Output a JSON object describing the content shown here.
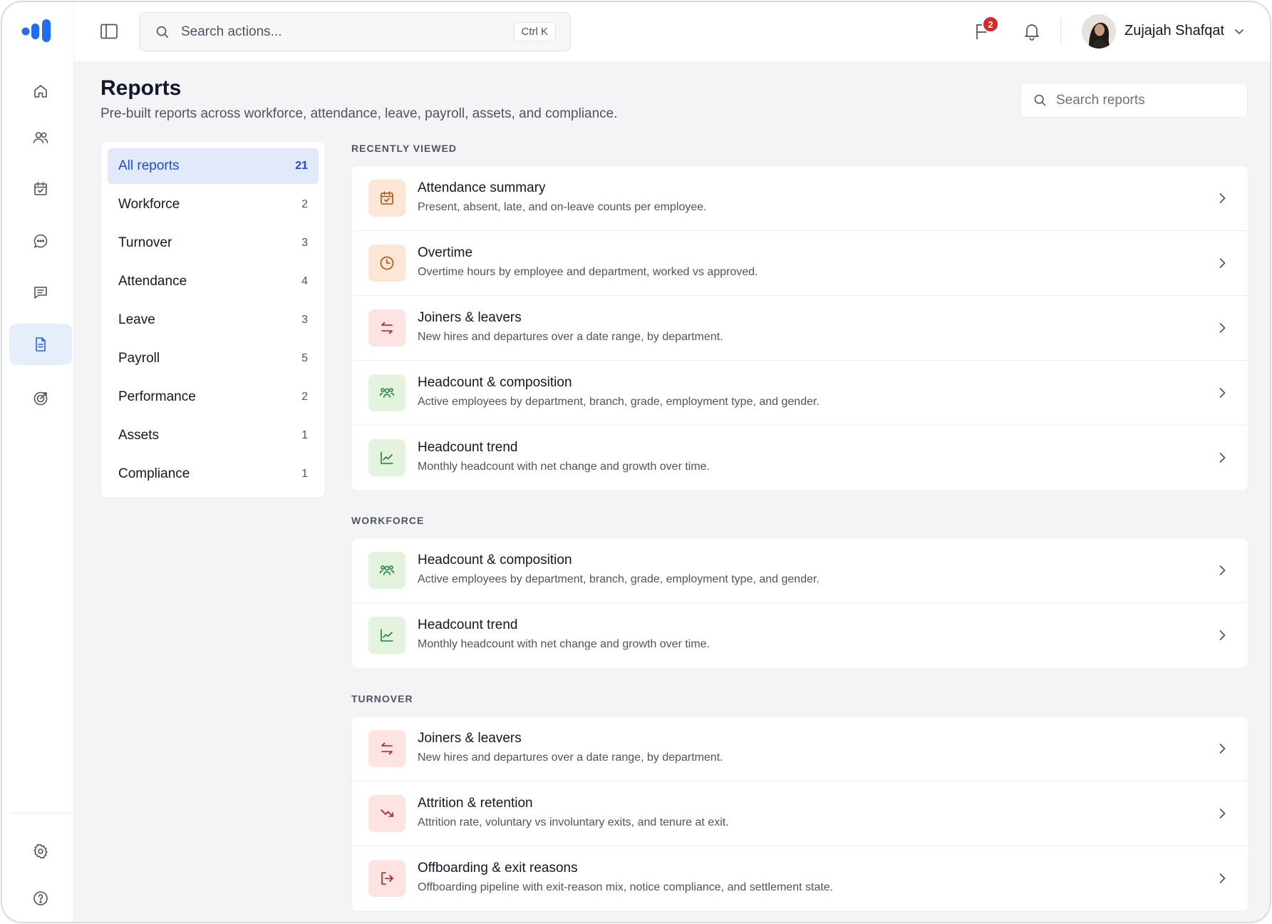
{
  "topbar": {
    "search_placeholder": "Search actions...",
    "search_shortcut": "Ctrl K",
    "announcement_count": "2",
    "user_name": "Zujajah Shafqat"
  },
  "rail": {
    "items": [
      "home-icon",
      "people-icon",
      "calendar-check-icon",
      "chat-icon",
      "messages-icon",
      "reports-icon",
      "target-icon"
    ],
    "active": "reports-icon",
    "bottom": [
      "settings-icon",
      "help-icon"
    ]
  },
  "page": {
    "title": "Reports",
    "subtitle": "Pre-built reports across workforce, attendance, leave, payroll, assets, and compliance.",
    "search_placeholder": "Search reports"
  },
  "categories": [
    {
      "name": "All reports",
      "count": "21",
      "active": true
    },
    {
      "name": "Workforce",
      "count": "2"
    },
    {
      "name": "Turnover",
      "count": "3"
    },
    {
      "name": "Attendance",
      "count": "4"
    },
    {
      "name": "Leave",
      "count": "3"
    },
    {
      "name": "Payroll",
      "count": "5"
    },
    {
      "name": "Performance",
      "count": "2"
    },
    {
      "name": "Assets",
      "count": "1"
    },
    {
      "name": "Compliance",
      "count": "1"
    }
  ],
  "sections": [
    {
      "label": "RECENTLY VIEWED",
      "reports": [
        {
          "title": "Attendance summary",
          "desc": "Present, absent, late, and on-leave counts per employee.",
          "icon": "calendar-check-icon",
          "tone": "orange"
        },
        {
          "title": "Overtime",
          "desc": "Overtime hours by employee and department, worked vs approved.",
          "icon": "clock-icon",
          "tone": "orange"
        },
        {
          "title": "Joiners & leavers",
          "desc": "New hires and departures over a date range, by department.",
          "icon": "swap-arrows-icon",
          "tone": "red"
        },
        {
          "title": "Headcount & composition",
          "desc": "Active employees by department, branch, grade, employment type, and gender.",
          "icon": "group-icon",
          "tone": "green"
        },
        {
          "title": "Headcount trend",
          "desc": "Monthly headcount with net change and growth over time.",
          "icon": "line-chart-icon",
          "tone": "green"
        }
      ]
    },
    {
      "label": "WORKFORCE",
      "reports": [
        {
          "title": "Headcount & composition",
          "desc": "Active employees by department, branch, grade, employment type, and gender.",
          "icon": "group-icon",
          "tone": "green"
        },
        {
          "title": "Headcount trend",
          "desc": "Monthly headcount with net change and growth over time.",
          "icon": "line-chart-icon",
          "tone": "green"
        }
      ]
    },
    {
      "label": "TURNOVER",
      "reports": [
        {
          "title": "Joiners & leavers",
          "desc": "New hires and departures over a date range, by department.",
          "icon": "swap-arrows-icon",
          "tone": "red"
        },
        {
          "title": "Attrition & retention",
          "desc": "Attrition rate, voluntary vs involuntary exits, and tenure at exit.",
          "icon": "trend-down-icon",
          "tone": "red"
        },
        {
          "title": "Offboarding & exit reasons",
          "desc": "Offboarding pipeline with exit-reason mix, notice compliance, and settlement state.",
          "icon": "exit-icon",
          "tone": "red"
        }
      ]
    }
  ]
}
